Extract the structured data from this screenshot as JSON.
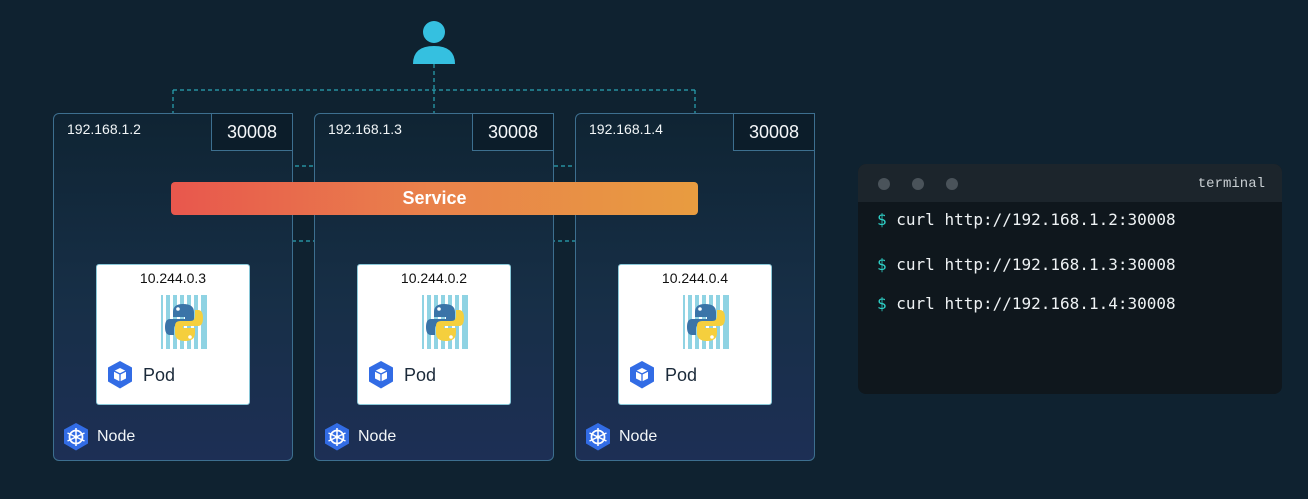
{
  "user": {
    "icon": "user-icon"
  },
  "nodes": [
    {
      "ip": "192.168.1.2",
      "port": "30008",
      "label": "Node",
      "pod": {
        "ip": "10.244.0.3",
        "label": "Pod"
      }
    },
    {
      "ip": "192.168.1.3",
      "port": "30008",
      "label": "Node",
      "pod": {
        "ip": "10.244.0.2",
        "label": "Pod"
      }
    },
    {
      "ip": "192.168.1.4",
      "port": "30008",
      "label": "Node",
      "pod": {
        "ip": "10.244.0.4",
        "label": "Pod"
      }
    }
  ],
  "service": {
    "label": "Service"
  },
  "terminal": {
    "title": "terminal",
    "prompt": "$",
    "lines": [
      "curl http://192.168.1.2:30008",
      "curl http://192.168.1.3:30008",
      "curl http://192.168.1.4:30008"
    ]
  },
  "colors": {
    "background": "#0f2230",
    "connector": "#2aa6b5",
    "service_start": "#e8574d",
    "service_end": "#e89c40",
    "prompt": "#2ed0c7"
  }
}
